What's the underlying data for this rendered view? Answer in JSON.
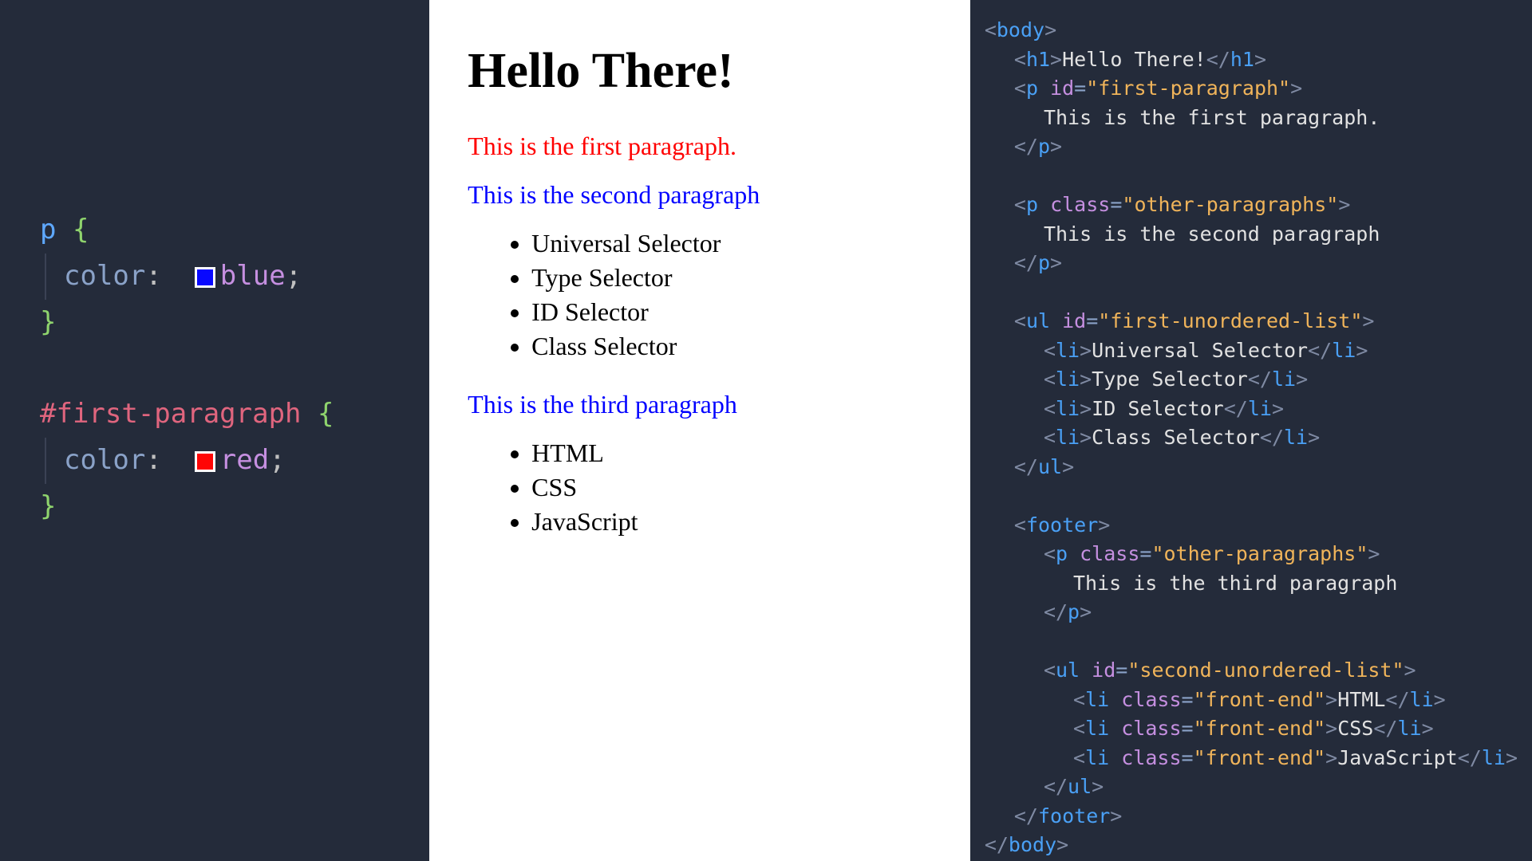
{
  "css": {
    "rule1_selector": "p",
    "rule1_prop": "color",
    "rule1_value": "blue",
    "rule2_selector": "#first-paragraph",
    "rule2_prop": "color",
    "rule2_value": "red"
  },
  "preview": {
    "heading": "Hello There!",
    "p1": "This is the first paragraph.",
    "p2": "This is the second paragraph",
    "list1": [
      "Universal Selector",
      "Type Selector",
      "ID Selector",
      "Class Selector"
    ],
    "p3": "This is the third paragraph",
    "list2": [
      "HTML",
      "CSS",
      "JavaScript"
    ]
  },
  "html": {
    "tags": {
      "body": "body",
      "h1": "h1",
      "p": "p",
      "ul": "ul",
      "li": "li",
      "footer": "footer"
    },
    "attrs": {
      "id": "id",
      "class": "class"
    },
    "vals": {
      "first_paragraph": "\"first-paragraph\"",
      "other_paragraphs": "\"other-paragraphs\"",
      "first_ul": "\"first-unordered-list\"",
      "second_ul": "\"second-unordered-list\"",
      "front_end": "\"front-end\""
    },
    "text": {
      "h1": "Hello There!",
      "p1": "This is the first paragraph.",
      "p2": "This is the second paragraph",
      "li1": "Universal Selector",
      "li2": "Type Selector",
      "li3": "ID Selector",
      "li4": "Class Selector",
      "p3": "This is the third paragraph",
      "li5": "HTML",
      "li6": "CSS",
      "li7": "JavaScript"
    }
  }
}
